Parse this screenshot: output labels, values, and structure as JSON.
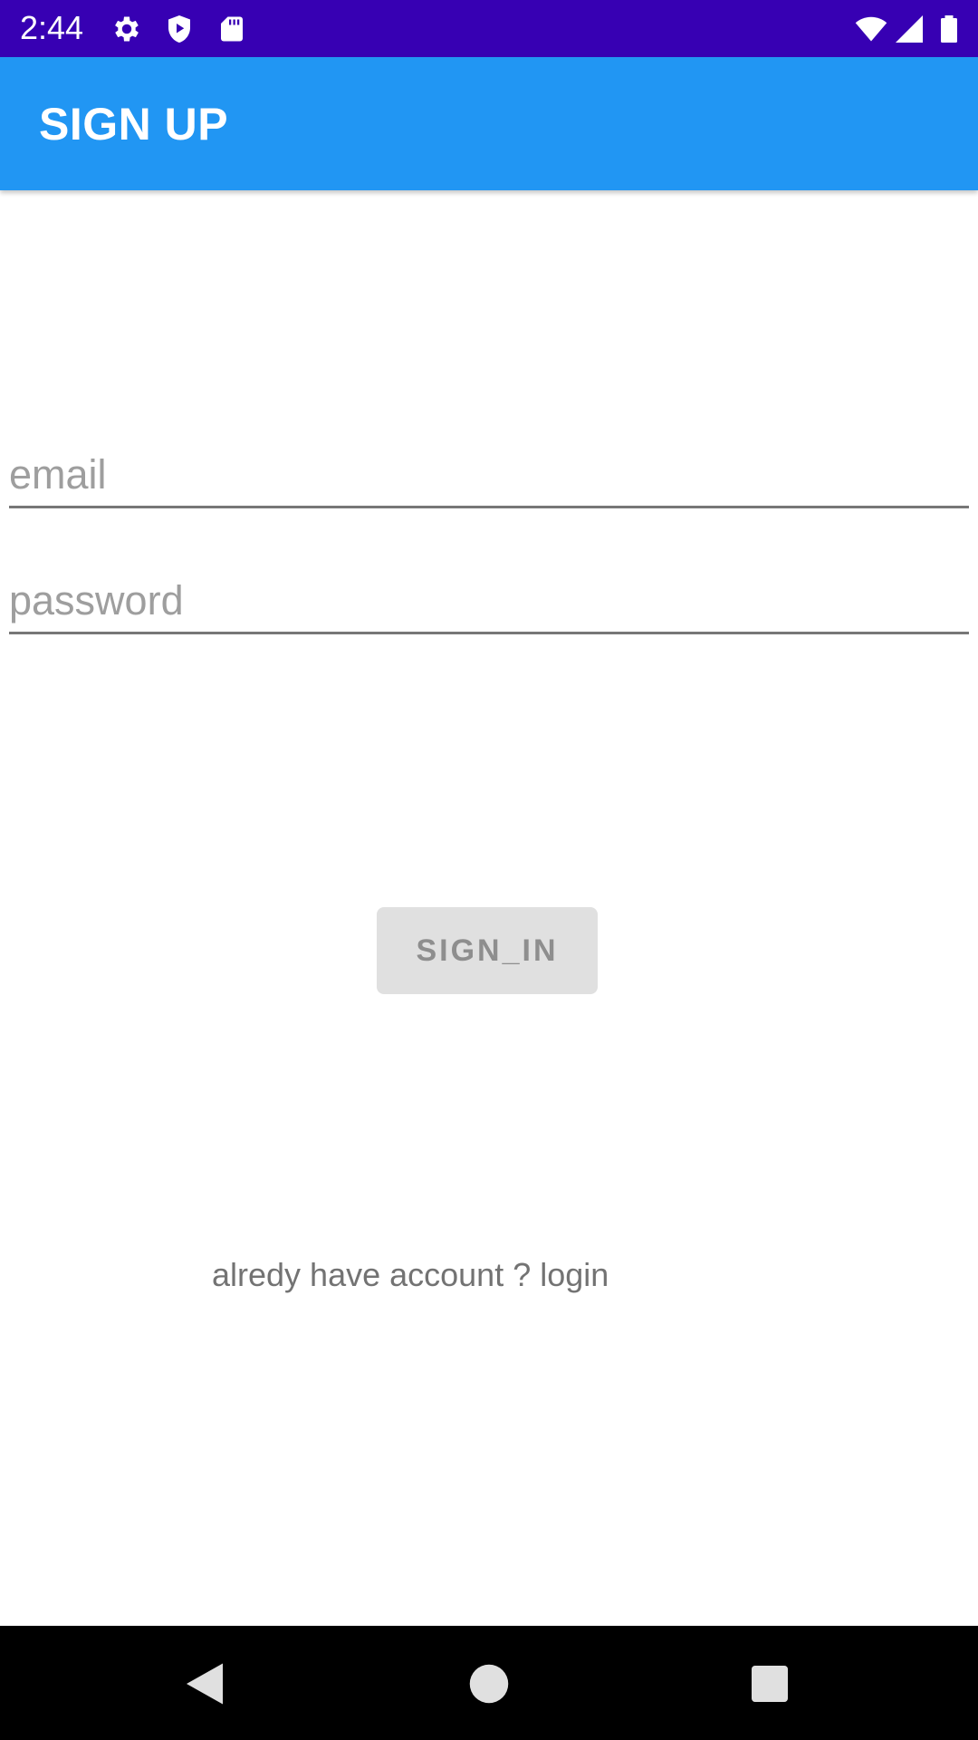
{
  "status_bar": {
    "time": "2:44",
    "icons": [
      "gear-icon",
      "shield-play-icon",
      "sd-card-icon",
      "wifi-icon",
      "cell-signal-icon",
      "battery-icon"
    ],
    "background": "#3700b3"
  },
  "app_bar": {
    "title": "SIGN UP",
    "background": "#2196f3"
  },
  "form": {
    "email_placeholder": "email",
    "email_value": "",
    "password_placeholder": "password",
    "password_value": "",
    "submit_label": "SIGN_IN",
    "login_link": "alredy have account ? login"
  },
  "nav_bar": {
    "icons": [
      "back-icon",
      "home-icon",
      "recents-icon"
    ]
  }
}
